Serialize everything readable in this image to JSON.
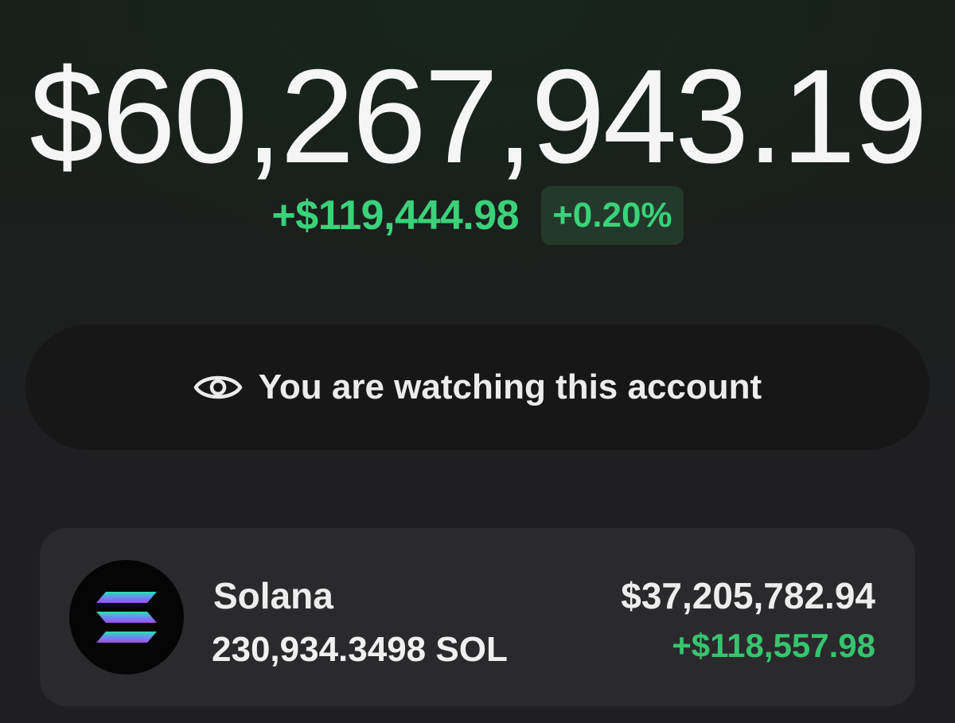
{
  "portfolio": {
    "total_balance": "$60,267,943.19",
    "change_amount": "+$119,444.98",
    "change_percent": "+0.20%"
  },
  "watch_banner": {
    "icon": "eye-icon",
    "text": "You are watching this account"
  },
  "tokens": [
    {
      "icon": "solana-logo-icon",
      "name": "Solana",
      "amount": "230,934.3498 SOL",
      "value": "$37,205,782.94",
      "change": "+$118,557.98"
    }
  ],
  "colors": {
    "positive": "#3ad27a",
    "positive_badge_bg": "#233a2b",
    "card_bg": "#2a2a2d",
    "pill_bg": "#171717"
  }
}
